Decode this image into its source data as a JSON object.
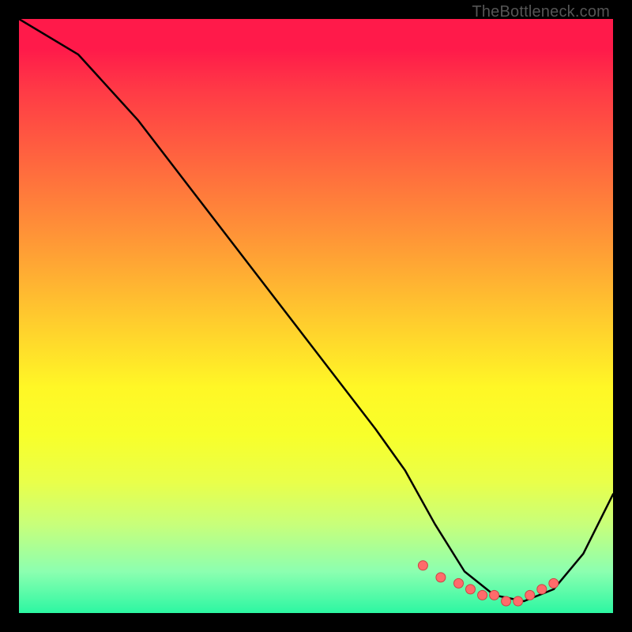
{
  "attribution": "TheBottleneck.com",
  "chart_data": {
    "type": "line",
    "title": "",
    "xlabel": "",
    "ylabel": "",
    "xlim": [
      0,
      100
    ],
    "ylim": [
      0,
      100
    ],
    "series": [
      {
        "name": "curve",
        "x": [
          0,
          10,
          20,
          30,
          40,
          50,
          60,
          65,
          70,
          75,
          80,
          85,
          90,
          95,
          100
        ],
        "y": [
          100,
          94,
          83,
          70,
          57,
          44,
          31,
          24,
          15,
          7,
          3,
          2,
          4,
          10,
          20
        ]
      }
    ],
    "markers": {
      "name": "dots",
      "x": [
        68,
        71,
        74,
        76,
        78,
        80,
        82,
        84,
        86,
        88,
        90
      ],
      "y": [
        8,
        6,
        5,
        4,
        3,
        3,
        2,
        2,
        3,
        4,
        5
      ]
    },
    "background": {
      "type": "vertical-gradient",
      "stops": [
        {
          "pos": 0.0,
          "color": "#ff1a4a"
        },
        {
          "pos": 0.5,
          "color": "#ffc92e"
        },
        {
          "pos": 0.75,
          "color": "#f8ff2a"
        },
        {
          "pos": 1.0,
          "color": "#2cf7a2"
        }
      ]
    }
  }
}
